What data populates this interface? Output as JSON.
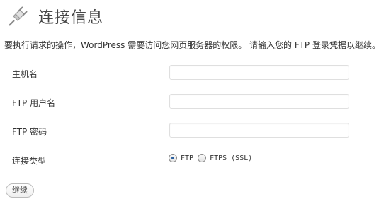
{
  "header": {
    "title": "连接信息",
    "icon": "plug-icon"
  },
  "intro": "要执行请求的操作，WordPress 需要访问您网页服务器的权限。 请输入您的 FTP 登录凭据以继续。",
  "form": {
    "hostname": {
      "label": "主机名",
      "value": ""
    },
    "username": {
      "label": "FTP 用户名",
      "value": ""
    },
    "password": {
      "label": "FTP 密码",
      "value": ""
    },
    "connection_type": {
      "label": "连接类型",
      "options": [
        {
          "label": "FTP",
          "selected": true
        },
        {
          "label": "FTPS (SSL)",
          "selected": false
        }
      ]
    }
  },
  "continue_label": "继续",
  "colors": {
    "radio_dot": "#2a5f9e",
    "title": "#464646"
  }
}
